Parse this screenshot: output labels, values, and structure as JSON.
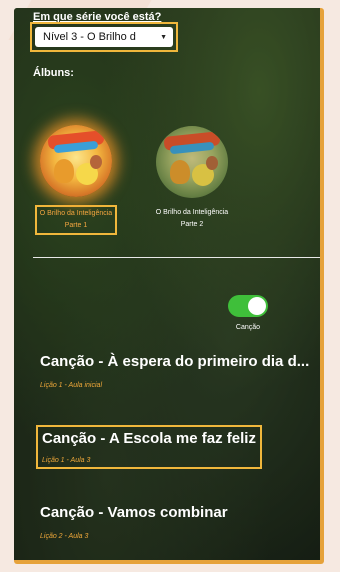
{
  "series": {
    "label": "Em que série você está?",
    "selected": "Nível 3 - O Brilho d"
  },
  "albums": {
    "label": "Álbuns:",
    "items": [
      {
        "name": "O Brilho da Inteligência",
        "part": "Parte 1",
        "selected": true
      },
      {
        "name": "O Brilho da Inteligência",
        "part": "Parte 2",
        "selected": false
      }
    ]
  },
  "filter": {
    "toggle_label": "Canção",
    "toggle_on": true
  },
  "songs": [
    {
      "title": "Canção - À espera do primeiro dia d...",
      "lesson": "Lição 1 - Aula inicial"
    },
    {
      "title": "Canção - A Escola me faz feliz",
      "lesson": "Lição 1 - Aula 3"
    },
    {
      "title": "Canção - Vamos combinar",
      "lesson": "Lição 2 - Aula 3"
    }
  ],
  "colors": {
    "accent": "#f0b73c",
    "toggle_on": "#3fbf3a",
    "lesson_text": "#f0a83a"
  }
}
